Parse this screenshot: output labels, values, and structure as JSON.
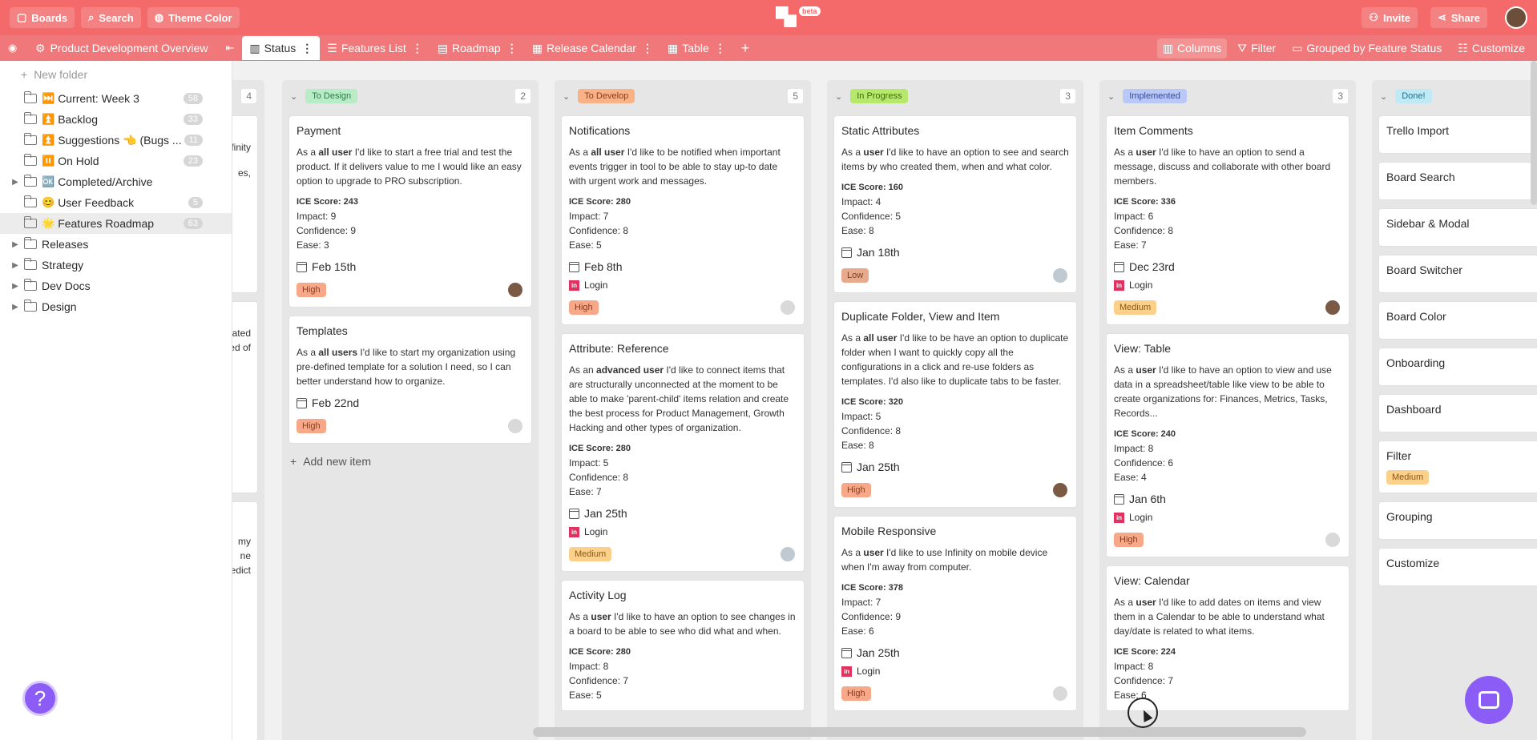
{
  "topbar": {
    "boards_label": "Boards",
    "search_label": "Search",
    "theme_label": "Theme Color",
    "beta_label": "beta",
    "invite_label": "Invite",
    "share_label": "Share",
    "color": "#f46a6a"
  },
  "tabbar": {
    "board_title": "Product Development Overview",
    "tabs": [
      {
        "label": "Status",
        "icon": "board-icon",
        "active": true
      },
      {
        "label": "Features List",
        "icon": "list-icon"
      },
      {
        "label": "Roadmap",
        "icon": "roadmap-icon"
      },
      {
        "label": "Release Calendar",
        "icon": "calendar-icon"
      },
      {
        "label": "Table",
        "icon": "table-icon"
      }
    ],
    "options": {
      "columns": "Columns",
      "filter": "Filter",
      "grouped": "Grouped by Feature Status",
      "customize": "Customize"
    }
  },
  "sidebar": {
    "new_folder": "New folder",
    "items": [
      {
        "emoji": "⏭️",
        "label": "Current: Week 3",
        "count": "58"
      },
      {
        "emoji": "⏫",
        "label": "Backlog",
        "count": "33"
      },
      {
        "emoji": "⏫",
        "label": "Suggestions 👈 (Bugs ...",
        "count": "11"
      },
      {
        "emoji": "⏸️",
        "label": "On Hold",
        "count": "23"
      },
      {
        "emoji": "🆗",
        "label": "Completed/Archive",
        "count": ""
      },
      {
        "emoji": "😊",
        "label": "User Feedback",
        "count": "5"
      },
      {
        "emoji": "🌟",
        "label": "Features Roadmap",
        "count": "63"
      },
      {
        "emoji": "",
        "label": "Releases",
        "count": ""
      },
      {
        "emoji": "",
        "label": "Strategy",
        "count": ""
      },
      {
        "emoji": "",
        "label": "Dev Docs",
        "count": ""
      },
      {
        "emoji": "",
        "label": "Design",
        "count": ""
      }
    ],
    "help_label": "?"
  },
  "partial_col": {
    "count": "4",
    "snippets": [
      "nfinity",
      "es,",
      "lated",
      "eed of",
      "my",
      "ne",
      "edict"
    ]
  },
  "columns": [
    {
      "status": "To Design",
      "count": "2",
      "status_bg": "#b7ecc7",
      "status_fg": "#2f7a45",
      "cards": [
        {
          "title": "Payment",
          "desc_pre": "As a ",
          "desc_bold": "all user",
          "desc_post": " I'd like to start a free trial and test the product. If it delivers value to me I would like an easy option to upgrade to PRO subscription.",
          "score": "ICE Score: 243",
          "impact": "Impact: 9",
          "confidence": "Confidence: 9",
          "ease": "Ease: 3",
          "date": "Feb 15th",
          "link": "",
          "priority": "High"
        },
        {
          "title": "Templates",
          "desc_pre": "As a ",
          "desc_bold": "all users",
          "desc_post": " I'd like to start my organization using pre-defined template for a solution I need, so I can better understand how to organize.",
          "score": "",
          "impact": "",
          "confidence": "",
          "ease": "",
          "date": "Feb 22nd",
          "link": "",
          "priority": "High"
        }
      ],
      "add_new": "Add new item"
    },
    {
      "status": "To Develop",
      "count": "5",
      "status_bg": "#f9b186",
      "status_fg": "#8a3b1c",
      "cards": [
        {
          "title": "Notifications",
          "desc_pre": "As a ",
          "desc_bold": "all user",
          "desc_post": " I'd like to be notified when important events trigger in tool to be able to stay up-to date with urgent work and messages.",
          "score": "ICE Score: 280",
          "impact": "Impact: 7",
          "confidence": "Confidence: 8",
          "ease": "Ease: 5",
          "date": "Feb 8th",
          "link": "Login",
          "priority": "High"
        },
        {
          "title": "Attribute: Reference",
          "desc_pre": "As an ",
          "desc_bold": "advanced user",
          "desc_post": " I'd like to connect items that are structurally unconnected at the moment to be able to make 'parent-child' items relation and create the best process for Product Management, Growth Hacking and other types of organization.",
          "score": "ICE Score: 280",
          "impact": "Impact: 5",
          "confidence": "Confidence: 8",
          "ease": "Ease: 7",
          "date": "Jan 25th",
          "link": "Login",
          "priority": "Medium"
        },
        {
          "title": "Activity Log",
          "desc_pre": "As a ",
          "desc_bold": "user",
          "desc_post": " I'd like to have an option to see changes in a board to be able to see who did what and when.",
          "score": "ICE Score: 280",
          "impact": "Impact: 8",
          "confidence": "Confidence: 7",
          "ease": "Ease: 5",
          "date": "",
          "link": "",
          "priority": ""
        }
      ]
    },
    {
      "status": "In Progress",
      "count": "3",
      "status_bg": "#b6e86c",
      "status_fg": "#3d6b10",
      "cards": [
        {
          "title": "Static Attributes",
          "desc_pre": "As a ",
          "desc_bold": "user",
          "desc_post": " I'd like to have an option to see and search items by who created them, when and what color.",
          "score": "ICE Score: 160",
          "impact": "Impact: 4",
          "confidence": "Confidence: 5",
          "ease": "Ease: 8",
          "date": "Jan 18th",
          "link": "",
          "priority": "Low"
        },
        {
          "title": "Duplicate Folder, View and Item",
          "desc_pre": "As a ",
          "desc_bold": "all user",
          "desc_post": " I'd like to be have an option to duplicate folder when I want to quickly copy all the configurations in a click and re-use folders as templates. I'd also like to duplicate tabs to be faster.",
          "score": "ICE Score: 320",
          "impact": "Impact: 5",
          "confidence": "Confidence: 8",
          "ease": "Ease: 8",
          "date": "Jan 25th",
          "link": "",
          "priority": "High"
        },
        {
          "title": "Mobile Responsive",
          "desc_pre": "As a ",
          "desc_bold": "user",
          "desc_post": " I'd like to use Infinity on mobile device when I'm away from computer.",
          "score": "ICE Score: 378",
          "impact": "Impact: 7",
          "confidence": "Confidence: 9",
          "ease": "Ease: 6",
          "date": "Jan 25th",
          "link": "Login",
          "priority": "High"
        }
      ]
    },
    {
      "status": "Implemented",
      "count": "3",
      "status_bg": "#b9c8f7",
      "status_fg": "#34489a",
      "cards": [
        {
          "title": "Item Comments",
          "desc_pre": "As a ",
          "desc_bold": "user",
          "desc_post": " I'd like to have an option to send a message, discuss and collaborate with other board members.",
          "score": "ICE Score: 336",
          "impact": "Impact: 6",
          "confidence": "Confidence: 8",
          "ease": "Ease: 7",
          "date": "Dec 23rd",
          "link": "Login",
          "priority": "Medium"
        },
        {
          "title": "View: Table",
          "desc_pre": "As a ",
          "desc_bold": "user",
          "desc_post": " I'd like to have an option to view and use data in a spreadsheet/table like view to be able to create organizations for: Finances, Metrics, Tasks, Records...",
          "score": "ICE Score: 240",
          "impact": "Impact: 8",
          "confidence": "Confidence: 6",
          "ease": "Ease: 4",
          "date": "Jan 6th",
          "link": "Login",
          "priority": "High"
        },
        {
          "title": "View: Calendar",
          "desc_pre": "As a ",
          "desc_bold": "user",
          "desc_post": " I'd like to add dates on items and view them in a Calendar to be able to understand what day/date is related to what items.",
          "score": "ICE Score: 224",
          "impact": "Impact: 8",
          "confidence": "Confidence: 7",
          "ease": "Ease: 6",
          "date": "",
          "link": "",
          "priority": ""
        }
      ]
    },
    {
      "status": "Done!",
      "count": "",
      "status_bg": "#bfe9f5",
      "status_fg": "#1f6f86",
      "cards": [
        {
          "title": "Trello Import"
        },
        {
          "title": "Board Search"
        },
        {
          "title": "Sidebar & Modal"
        },
        {
          "title": "Board Switcher"
        },
        {
          "title": "Board Color"
        },
        {
          "title": "Onboarding"
        },
        {
          "title": "Dashboard"
        },
        {
          "title": "Filter",
          "priority": "Medium"
        },
        {
          "title": "Grouping"
        },
        {
          "title": "Customize"
        }
      ]
    }
  ]
}
